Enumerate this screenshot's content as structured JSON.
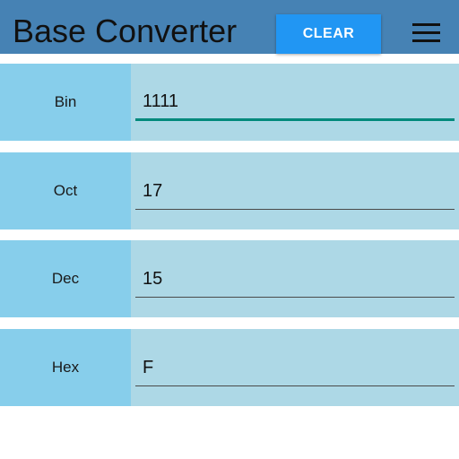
{
  "toolbar": {
    "title": "Base Converter",
    "clear_label": "CLEAR",
    "menu_icon": "hamburger-menu-icon",
    "color": "#4682b4",
    "button_color": "#2196f3"
  },
  "rows": [
    {
      "label": "Bin",
      "value": "1111",
      "focused": true
    },
    {
      "label": "Oct",
      "value": "17"
    },
    {
      "label": "Dec",
      "value": "15"
    },
    {
      "label": "Hex",
      "value": "F"
    }
  ],
  "colors": {
    "label_bg": "#87ceeb",
    "field_bg": "#add8e6",
    "focus_underline": "#00897b"
  }
}
